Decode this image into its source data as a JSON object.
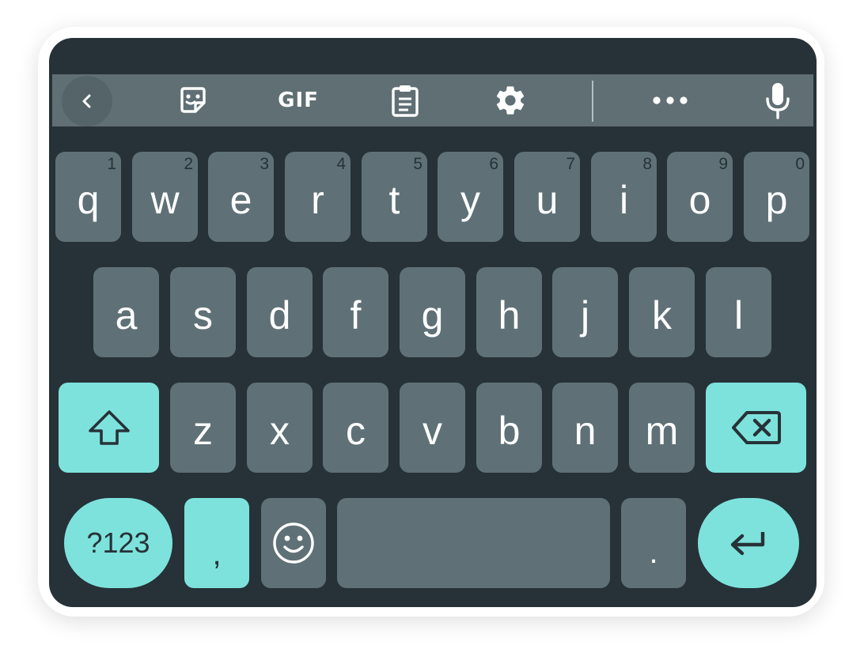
{
  "toolbar": {
    "items": [
      {
        "icon": "chevron-left-icon"
      },
      {
        "icon": "sticker-icon"
      },
      {
        "icon": "gif-icon",
        "label": "GIF"
      },
      {
        "icon": "clipboard-icon"
      },
      {
        "icon": "gear-icon"
      },
      {
        "icon": "more-horizontal-icon"
      },
      {
        "icon": "microphone-icon"
      }
    ]
  },
  "rows": {
    "row1": [
      {
        "letter": "q",
        "hint": "1"
      },
      {
        "letter": "w",
        "hint": "2"
      },
      {
        "letter": "e",
        "hint": "3"
      },
      {
        "letter": "r",
        "hint": "4"
      },
      {
        "letter": "t",
        "hint": "5"
      },
      {
        "letter": "y",
        "hint": "6"
      },
      {
        "letter": "u",
        "hint": "7"
      },
      {
        "letter": "i",
        "hint": "8"
      },
      {
        "letter": "o",
        "hint": "9"
      },
      {
        "letter": "p",
        "hint": "0"
      }
    ],
    "row2": [
      {
        "letter": "a"
      },
      {
        "letter": "s"
      },
      {
        "letter": "d"
      },
      {
        "letter": "f"
      },
      {
        "letter": "g"
      },
      {
        "letter": "h"
      },
      {
        "letter": "j"
      },
      {
        "letter": "k"
      },
      {
        "letter": "l"
      }
    ],
    "row3": [
      {
        "letter": "z"
      },
      {
        "letter": "x"
      },
      {
        "letter": "c"
      },
      {
        "letter": "v"
      },
      {
        "letter": "b"
      },
      {
        "letter": "n"
      },
      {
        "letter": "m"
      }
    ]
  },
  "special": {
    "shift_icon": "shift-arrow-icon",
    "backspace_icon": "backspace-icon",
    "symbols_label": "?123",
    "comma_label": ",",
    "emoji_icon": "smiley-icon",
    "space_label": "",
    "period_label": ".",
    "enter_icon": "enter-arrow-icon"
  },
  "colors": {
    "background": "#263238",
    "toolbar": "#5f6f74",
    "key": "#5f7177",
    "accent": "#7ee2dc",
    "hint": "#263238",
    "text": "#ffffff"
  }
}
